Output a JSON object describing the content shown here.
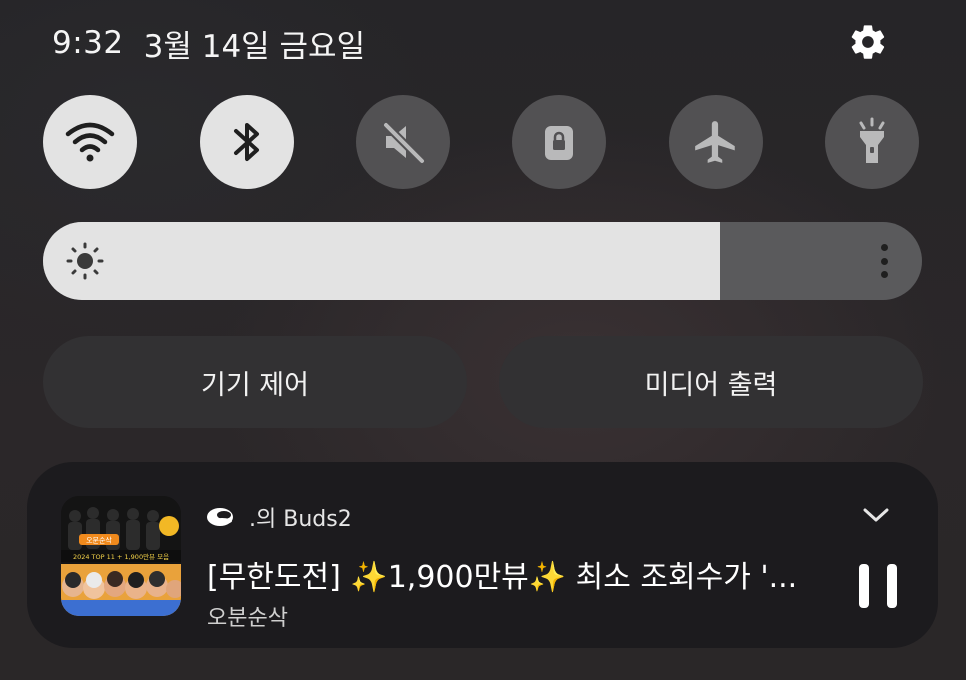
{
  "status": {
    "time": "9:32",
    "date": "3월 14일 금요일"
  },
  "quick_settings": {
    "toggles": [
      {
        "name": "wifi",
        "icon": "wifi-icon",
        "state": "on"
      },
      {
        "name": "bluetooth",
        "icon": "bluetooth-icon",
        "state": "on"
      },
      {
        "name": "sound",
        "icon": "mute-icon",
        "state": "off"
      },
      {
        "name": "rotation-lock",
        "icon": "lock-icon",
        "state": "off"
      },
      {
        "name": "airplane-mode",
        "icon": "airplane-icon",
        "state": "off"
      },
      {
        "name": "flashlight",
        "icon": "flashlight-icon",
        "state": "off"
      }
    ],
    "brightness_level": 0.77
  },
  "buttons": {
    "device_control": "기기 제어",
    "media_output": "미디어 출력"
  },
  "media": {
    "output_device": ".의 Buds2",
    "title": "[무한도전] ✨1,900만뷰✨ 최소 조회수가 '...",
    "artist": "오분순삭",
    "state": "playing",
    "thumbnail_text": {
      "brand": "오분순삭",
      "line": "2024 TOP 11 + 1,900만뷰 모음"
    }
  },
  "colors": {
    "toggle_on": "#e3e3e3",
    "toggle_off": "#525153",
    "pill_bg": "#323133",
    "media_bg": "#1c1b1e"
  }
}
